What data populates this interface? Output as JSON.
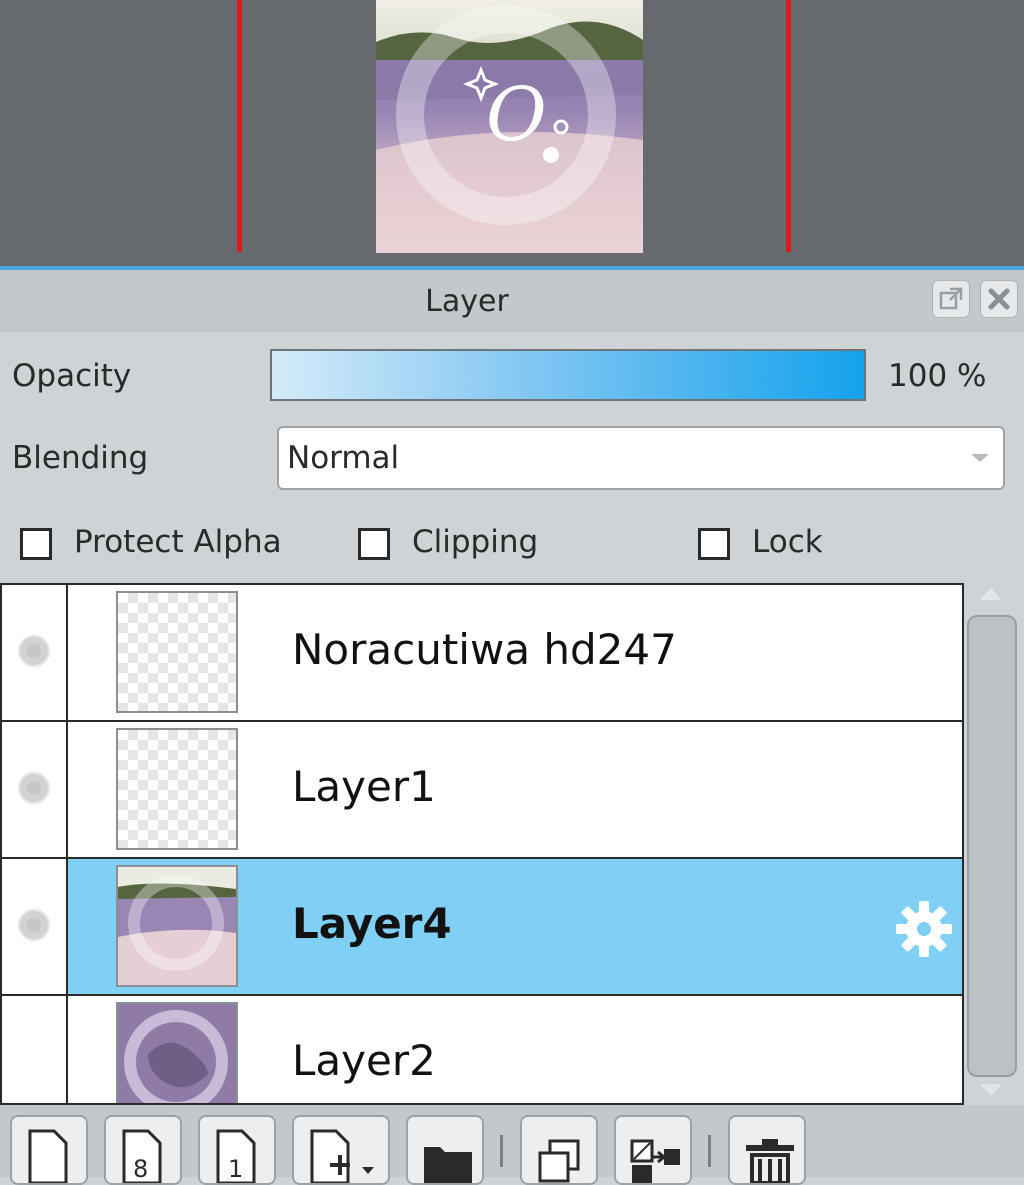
{
  "panel": {
    "title": "Layer",
    "undock_icon": "undock-icon",
    "close_icon": "close-icon"
  },
  "opacity": {
    "label": "Opacity",
    "value_text": "100 %",
    "level": 1.0,
    "fill_color": "#14a2ec"
  },
  "blending": {
    "label": "Blending",
    "selected": "Normal"
  },
  "options": {
    "protect_alpha": {
      "label": "Protect Alpha",
      "checked": false
    },
    "clipping": {
      "label": "Clipping",
      "checked": false
    },
    "lock": {
      "label": "Lock",
      "checked": false
    }
  },
  "layers": [
    {
      "name": "Noracutiwa hd247",
      "visible": true,
      "selected": false,
      "thumbnail": "transparent"
    },
    {
      "name": "Layer1",
      "visible": true,
      "selected": false,
      "thumbnail": "transparent"
    },
    {
      "name": "Layer4",
      "visible": true,
      "selected": true,
      "thumbnail": "lavender-field",
      "settings_icon": "gear-icon"
    },
    {
      "name": "Layer2",
      "visible": false,
      "selected": false,
      "thumbnail": "purple-pattern"
    }
  ],
  "toolbar": {
    "items": [
      "new-layer-icon",
      "new-8bit-layer-icon",
      "new-1bit-layer-icon",
      "add-layer-menu-icon",
      "new-folder-icon",
      "duplicate-layer-icon",
      "merge-down-icon",
      "delete-layer-icon"
    ]
  },
  "colors": {
    "selected_row": "#80d0f6",
    "guide_line": "#e0191e",
    "canvas_bg": "#666a6f"
  }
}
